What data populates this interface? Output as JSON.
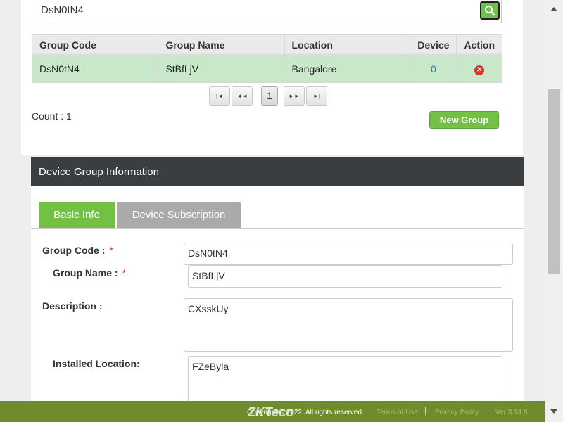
{
  "search": {
    "value": "DsN0tN4"
  },
  "table": {
    "headers": [
      "Group Code",
      "Group Name",
      "Location",
      "Device",
      "Action"
    ],
    "rows": [
      {
        "group_code": "DsN0tN4",
        "group_name": "StBfLjV",
        "location": "Bangalore",
        "device": "0"
      }
    ]
  },
  "pager": {
    "first": "|◄",
    "prev": "◄◄",
    "current": "1",
    "next": "►►",
    "last": "►|"
  },
  "count_text": "Count : 1",
  "new_group_label": "New Group",
  "info": {
    "header": "Device Group Information",
    "tabs": [
      "Basic Info",
      "Device Subscription"
    ],
    "fields": {
      "group_code": {
        "label": "Group Code :",
        "value": "DsN0tN4"
      },
      "group_name": {
        "label": "Group Name :",
        "value": "StBfLjV"
      },
      "description": {
        "label": "Description :",
        "value": "CXsskUy"
      },
      "installed_location": {
        "label": "Installed Location:",
        "value": "FZeByla"
      }
    },
    "required_marker": "*"
  },
  "footer": {
    "logo": "ZKTeco",
    "copyright": "Copyright © 2022. All rights reserved.",
    "terms": "Terms of Use",
    "privacy": "Privacy Policy",
    "version": "Ver 3.14.8"
  },
  "colors": {
    "accent": "#73c045",
    "selected_row": "#c9e7c9",
    "header_dark": "#3b3e40",
    "footer": "#6d8c2c"
  }
}
